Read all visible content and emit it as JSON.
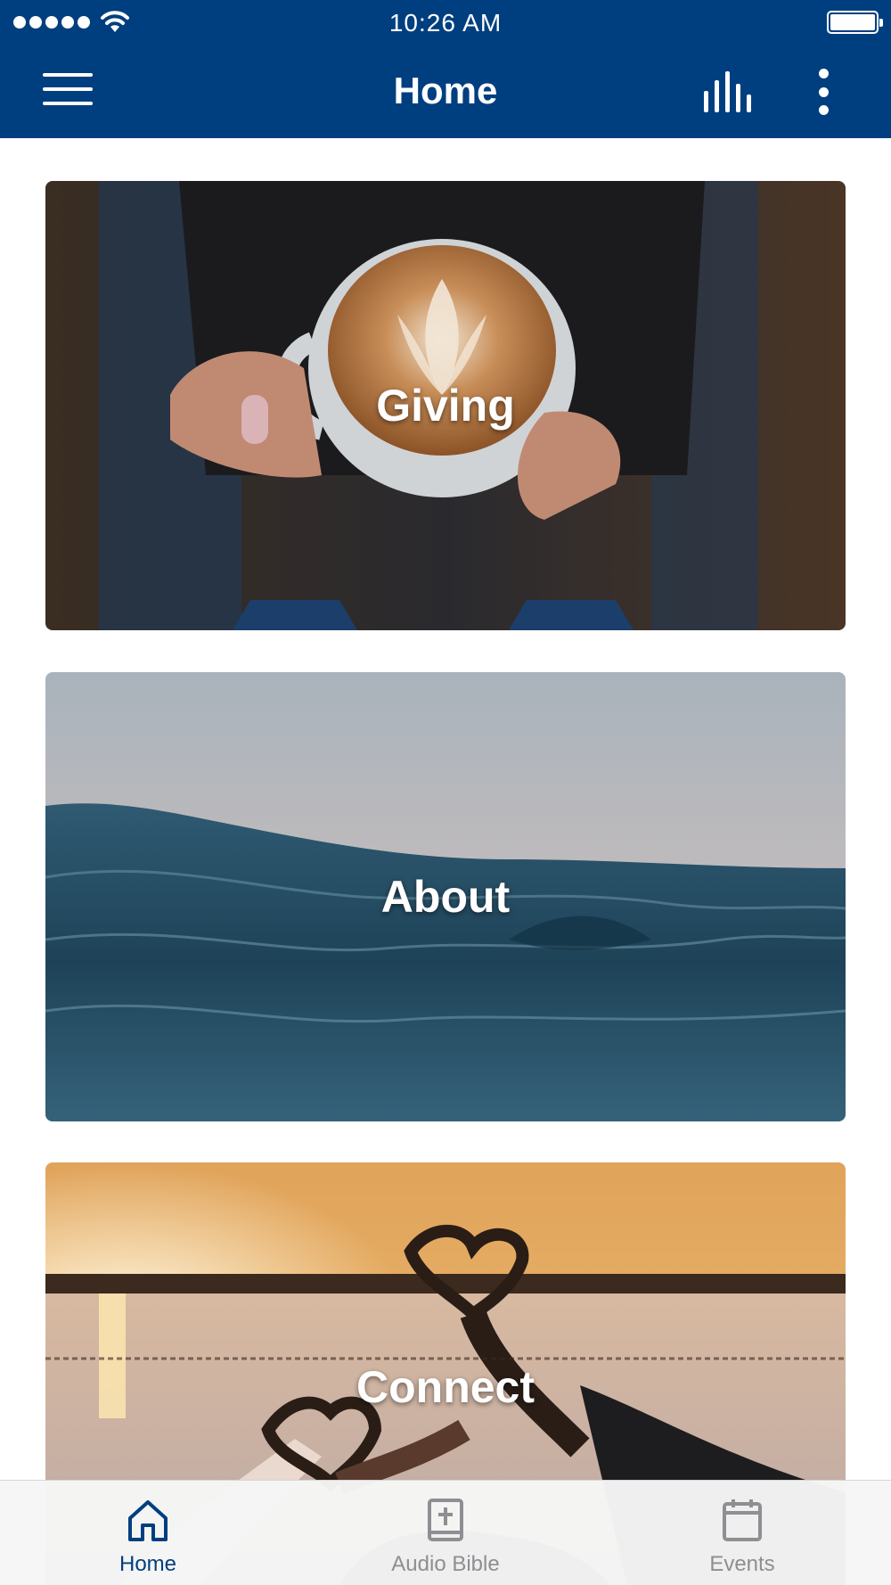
{
  "status_bar": {
    "time": "10:26 AM"
  },
  "header": {
    "title": "Home"
  },
  "cards": [
    {
      "label": "Giving"
    },
    {
      "label": "About"
    },
    {
      "label": "Connect"
    }
  ],
  "tabs": [
    {
      "label": "Home",
      "icon": "home-icon",
      "active": true
    },
    {
      "label": "Audio Bible",
      "icon": "bible-icon",
      "active": false
    },
    {
      "label": "Events",
      "icon": "calendar-icon",
      "active": false
    }
  ],
  "colors": {
    "header": "#003f7f",
    "tab_active": "#003f7f",
    "tab_inactive": "#8e8e93"
  }
}
